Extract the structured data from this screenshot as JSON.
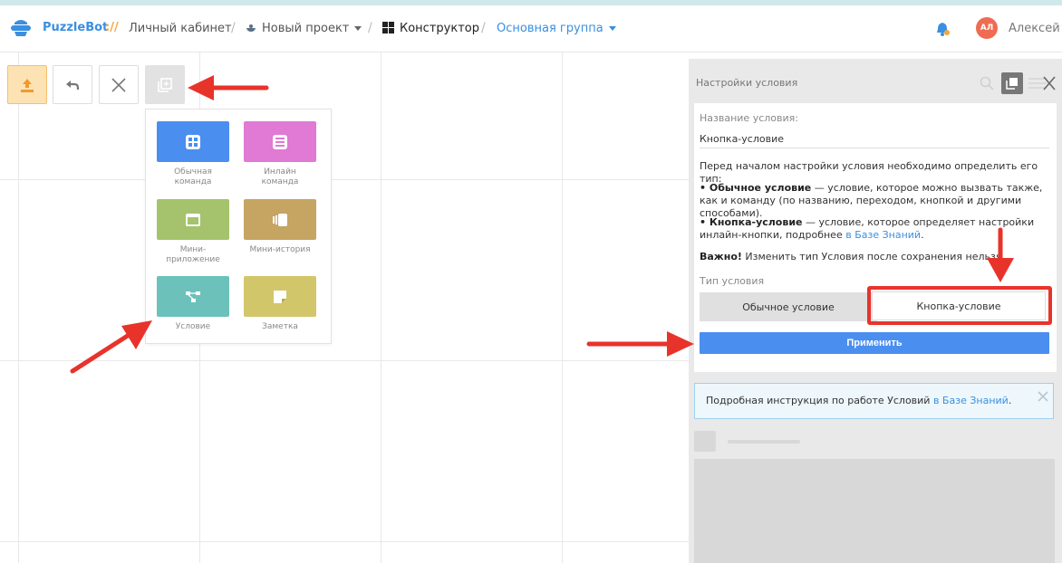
{
  "header": {
    "brand": "PuzzleBot",
    "brand_sep": "://",
    "crumbs": {
      "cabinet": "Личный кабинет",
      "project": "Новый проект",
      "constructor": "Конструктор",
      "group": "Основная группа"
    },
    "avatar_initials": "АЛ",
    "username": "Алексей"
  },
  "toolbar": {
    "icons": [
      "upload-icon",
      "undo-icon",
      "close-icon",
      "add-block-icon"
    ]
  },
  "dropdown": {
    "items": [
      {
        "label": "Обычная\nкоманда",
        "color": "#4a8ef0",
        "icon": "grid-icon"
      },
      {
        "label": "Инлайн\nкоманда",
        "color": "#e07ad4",
        "icon": "list-icon"
      },
      {
        "label": "Мини-\nприложение",
        "color": "#a4c36c",
        "icon": "window-icon"
      },
      {
        "label": "Мини-история",
        "color": "#c6a462",
        "icon": "stories-icon"
      },
      {
        "label": "Условие",
        "color": "#6cc1bb",
        "icon": "branch-icon"
      },
      {
        "label": "Заметка",
        "color": "#d2c66a",
        "icon": "note-icon"
      }
    ]
  },
  "panel": {
    "title": "Настройки условия",
    "name_label": "Название условия:",
    "name_value": "Кнопка-условие",
    "intro": "Перед началом настройки условия необходимо определить его тип:",
    "bullet1_bold": "• Обычное условие",
    "bullet1_text": " — условие, которое можно вызвать также, как и команду (по названию, переходом, кнопкой и другими способами).",
    "bullet2_bold": "• Кнопка-условие",
    "bullet2_text": " — условие, которое определяет настройки инлайн-кнопки, подробнее ",
    "bullet2_link": "в Базе Знаний",
    "bullet2_end": ".",
    "important_bold": "Важно!",
    "important_text": " Изменить тип Условия после сохранения нельзя.",
    "type_label": "Тип условия",
    "type_option_1": "Обычное условие",
    "type_option_2": "Кнопка-условие",
    "selected_type": "Кнопка-условие",
    "apply_label": "Применить",
    "info_text": "Подробная инструкция по работе Условий ",
    "info_link": "в Базе Знаний",
    "info_end": "."
  },
  "colors": {
    "accent": "#3a8fe0",
    "apply": "#4a8ef0",
    "annotation_red": "#e8332b"
  }
}
